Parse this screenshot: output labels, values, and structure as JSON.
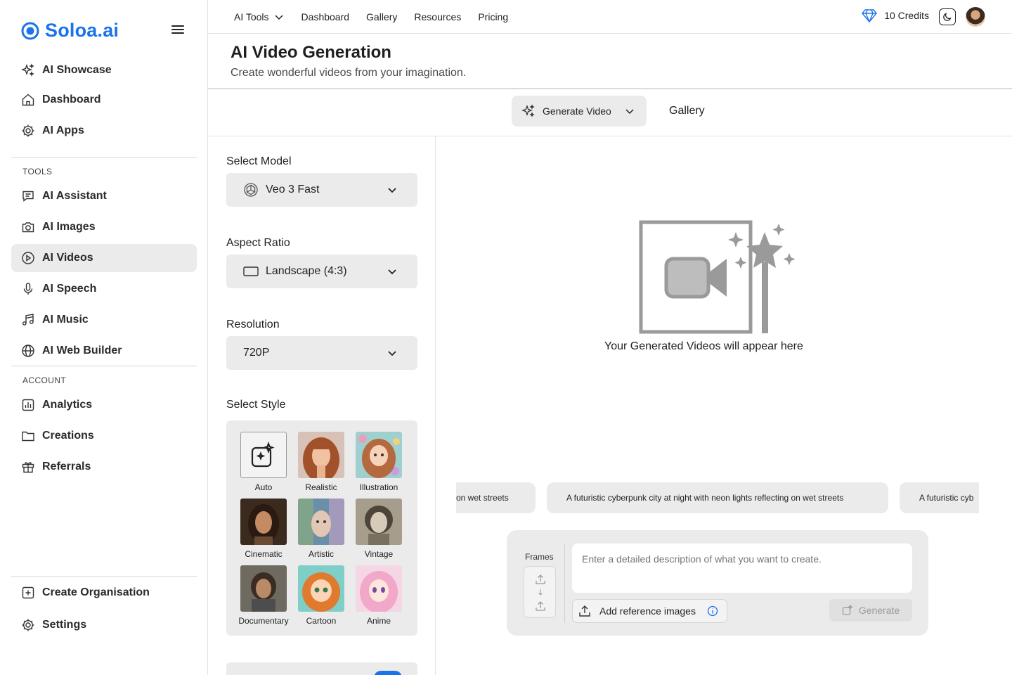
{
  "app": {
    "name": "Soloa.ai",
    "accent": "#1a73e8"
  },
  "sidebar": {
    "main_items": [
      {
        "label": "AI Showcase",
        "icon": "sparkles-icon"
      },
      {
        "label": "Dashboard",
        "icon": "home-icon"
      },
      {
        "label": "AI Apps",
        "icon": "gear-icon"
      }
    ],
    "tools_label": "TOOLS",
    "tools_items": [
      {
        "label": "AI Assistant",
        "icon": "chat-icon"
      },
      {
        "label": "AI Images",
        "icon": "camera-icon"
      },
      {
        "label": "AI Videos",
        "icon": "play-circle-icon",
        "active": true
      },
      {
        "label": "AI Speech",
        "icon": "microphone-icon"
      },
      {
        "label": "AI Music",
        "icon": "music-note-icon"
      },
      {
        "label": "AI Web Builder",
        "icon": "globe-icon"
      }
    ],
    "account_label": "ACCOUNT",
    "account_items": [
      {
        "label": "Analytics",
        "icon": "bar-chart-icon"
      },
      {
        "label": "Creations",
        "icon": "folder-icon"
      },
      {
        "label": "Referrals",
        "icon": "gift-icon"
      }
    ],
    "bottom_items": [
      {
        "label": "Create Organisation",
        "icon": "plus-square-icon"
      },
      {
        "label": "Settings",
        "icon": "gear-icon"
      }
    ]
  },
  "topbar": {
    "nav": [
      "AI Tools",
      "Dashboard",
      "Gallery",
      "Resources",
      "Pricing"
    ],
    "credits": "10 Credits"
  },
  "page": {
    "title": "AI Video Generation",
    "subtitle": "Create wonderful videos from your imagination."
  },
  "tabs": {
    "generate": "Generate Video",
    "gallery": "Gallery"
  },
  "form": {
    "model_label": "Select Model",
    "model_value": "Veo 3 Fast",
    "aspect_label": "Aspect Ratio",
    "aspect_value": "Landscape (4:3)",
    "resolution_label": "Resolution",
    "resolution_value": "720P",
    "style_label": "Select Style",
    "styles": [
      "Auto",
      "Realistic",
      "Illustration",
      "Cinematic",
      "Artistic",
      "Vintage",
      "Documentary",
      "Cartoon",
      "Anime"
    ]
  },
  "empty_state": {
    "text": "Your Generated Videos will appear here"
  },
  "suggestions": [
    "on wet streets",
    "A futuristic cyberpunk city at night with neon lights reflecting on wet streets",
    "A futuristic cyb"
  ],
  "composer": {
    "frames_label": "Frames",
    "placeholder": "Enter a detailed description of what you want to create.",
    "add_reference": "Add reference images",
    "generate": "Generate"
  }
}
